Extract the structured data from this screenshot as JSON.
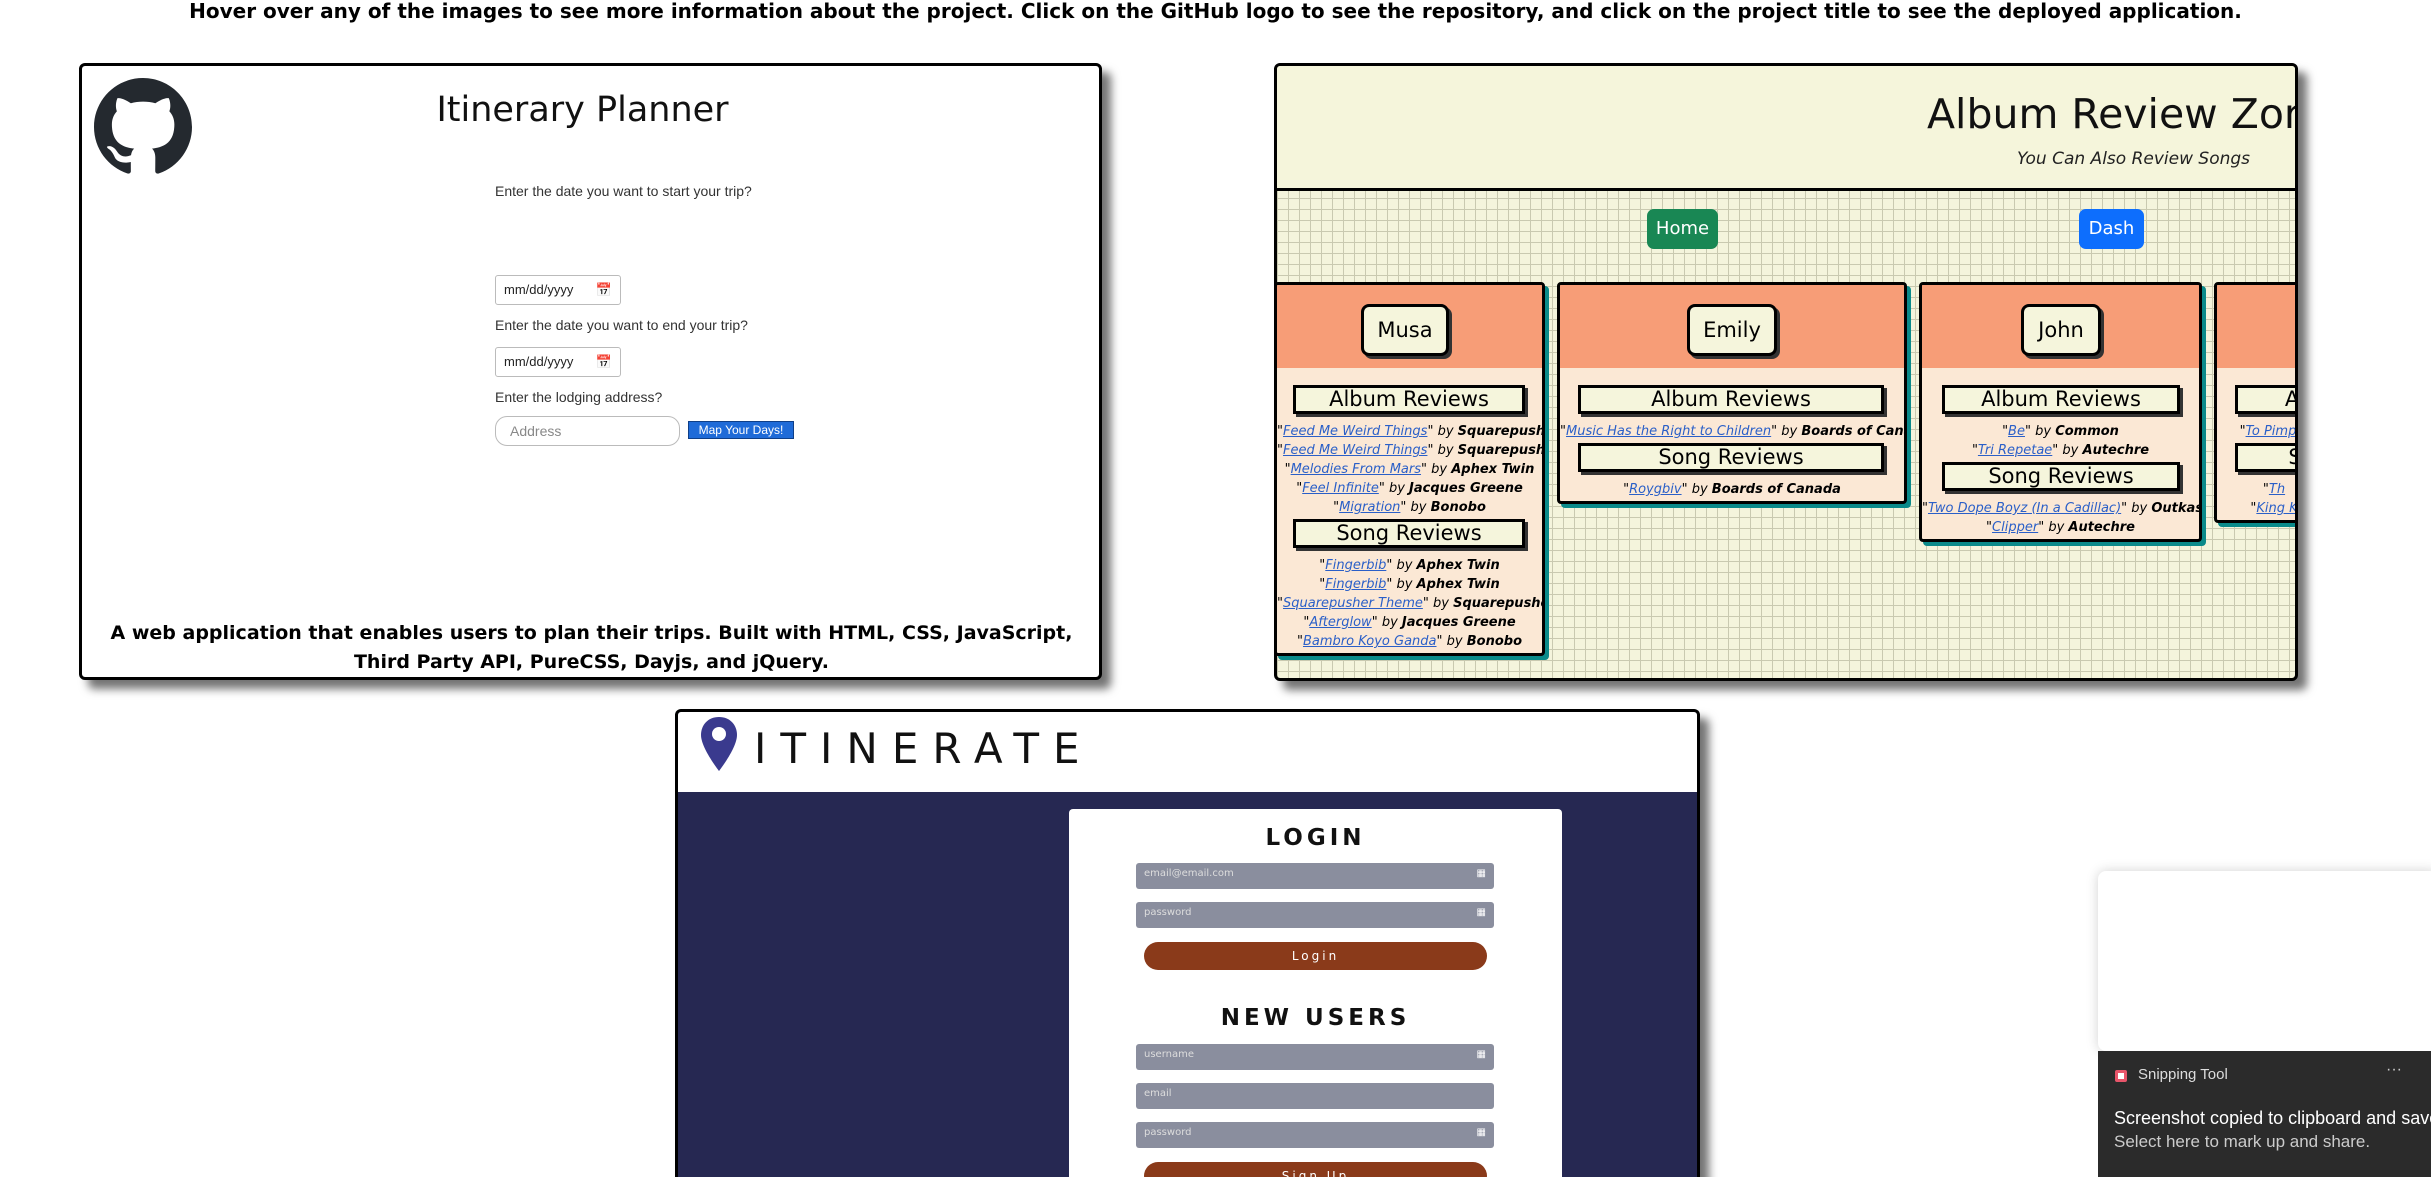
{
  "intro": "Hover over any of the images to see more information about the project. Click on the GitHub logo to see the repository, and click on the project title to see the deployed application.",
  "itinerary_planner": {
    "title": "Itinerary Planner",
    "clipped_question": "Enter the date you want to start your trip?",
    "start_date_placeholder": "mm/dd/yyyy",
    "end_question": "Enter the date you want to end your trip?",
    "end_date_placeholder": "mm/dd/yyyy",
    "lodging_question": "Enter the lodging address?",
    "address_placeholder": "Address",
    "map_button": "Map Your Days!",
    "description": "A web application that enables users to plan their trips. Built with HTML, CSS, JavaScript, Third Party API, PureCSS, Dayjs, and jQuery."
  },
  "album_review": {
    "title": "Album Review Zone",
    "subtitle": "You Can Also Review Songs",
    "home_button": "Home",
    "dash_button": "Dash",
    "album_reviews_label": "Album Reviews",
    "song_reviews_label": "Song Reviews",
    "users": [
      {
        "name": "Musa",
        "albums": [
          {
            "title": "Feed Me Weird Things",
            "by": "by",
            "artist": "Squarepusher"
          },
          {
            "title": "Feed Me Weird Things",
            "by": "by",
            "artist": "Squarepusher"
          },
          {
            "title": "Melodies From Mars",
            "by": "by",
            "artist": "Aphex Twin"
          },
          {
            "title": "Feel Infinite",
            "by": "by",
            "artist": "Jacques Greene"
          },
          {
            "title": "Migration",
            "by": "by",
            "artist": "Bonobo"
          }
        ],
        "songs": [
          {
            "title": "Fingerbib",
            "by": "by",
            "artist": "Aphex Twin"
          },
          {
            "title": "Fingerbib",
            "by": "by",
            "artist": "Aphex Twin"
          },
          {
            "title": "Squarepusher Theme",
            "by": "by",
            "artist": "Squarepusher"
          },
          {
            "title": "Afterglow",
            "by": "by",
            "artist": "Jacques Greene"
          },
          {
            "title": "Bambro Koyo Ganda",
            "by": "by",
            "artist": "Bonobo"
          }
        ]
      },
      {
        "name": "Emily",
        "albums": [
          {
            "title": "Music Has the Right to Children",
            "by": "by",
            "artist": "Boards of Canada"
          }
        ],
        "songs": [
          {
            "title": "Roygbiv",
            "by": "by",
            "artist": "Boards of Canada"
          }
        ]
      },
      {
        "name": "John",
        "albums": [
          {
            "title": "Be",
            "by": "by",
            "artist": "Common"
          },
          {
            "title": "Tri Repetae",
            "by": "by",
            "artist": "Autechre"
          }
        ],
        "songs": [
          {
            "title": "Two Dope Boyz (In a Cadillac)",
            "by": "by",
            "artist": "Outkast"
          },
          {
            "title": "Clipper",
            "by": "by",
            "artist": "Autechre"
          }
        ]
      },
      {
        "name": "",
        "album_label_visible": "Al",
        "song_label_visible": "S",
        "albums": [
          {
            "title": "To Pimp a",
            "by": "",
            "artist": ""
          }
        ],
        "songs": [
          {
            "title": "Th",
            "by": "",
            "artist": ""
          },
          {
            "title": "King K",
            "by": "",
            "artist": ""
          }
        ]
      }
    ]
  },
  "itinerate": {
    "brand": "ITINERATE",
    "login_heading": "LOGIN",
    "email_placeholder": "email@email.com",
    "password_placeholder": "password",
    "login_button": "Login",
    "new_users_heading": "NEW USERS",
    "username_placeholder": "username",
    "signup_email_placeholder": "email",
    "signup_password_placeholder": "password",
    "signup_button": "Sign Up"
  },
  "toast": {
    "app": "Snipping Tool",
    "more": "···",
    "message": "Screenshot copied to clipboard and saved",
    "sub": "Select here to mark up and share."
  }
}
